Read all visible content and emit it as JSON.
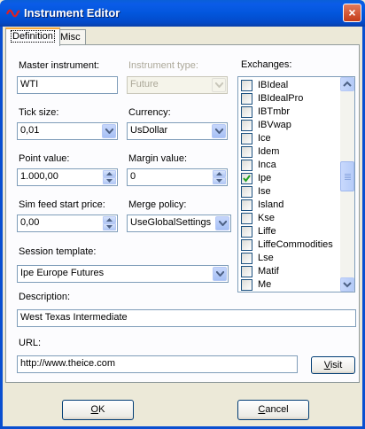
{
  "window": {
    "title": "Instrument Editor",
    "close": "×"
  },
  "tabs": [
    {
      "label": "Definition",
      "active": true
    },
    {
      "label": "Misc",
      "active": false
    }
  ],
  "form": {
    "master_instrument": {
      "label": "Master instrument:",
      "value": "WTI"
    },
    "instrument_type": {
      "label": "Instrument type:",
      "value": "Future"
    },
    "tick_size": {
      "label": "Tick size:",
      "value": "0,01"
    },
    "currency": {
      "label": "Currency:",
      "value": "UsDollar"
    },
    "point_value": {
      "label": "Point value:",
      "value": "1.000,00"
    },
    "margin_value": {
      "label": "Margin value:",
      "value": "0"
    },
    "sim_feed_start_price": {
      "label": "Sim feed start price:",
      "value": "0,00"
    },
    "merge_policy": {
      "label": "Merge policy:",
      "value": "UseGlobalSettings"
    },
    "session_template": {
      "label": "Session template:",
      "value": "Ipe Europe Futures"
    },
    "description": {
      "label": "Description:",
      "value": "West Texas Intermediate"
    },
    "url": {
      "label": "URL:",
      "value": "http://www.theice.com"
    }
  },
  "exchanges": {
    "label": "Exchanges:",
    "items": [
      {
        "name": "IBIdeal",
        "checked": false
      },
      {
        "name": "IBIdealPro",
        "checked": false
      },
      {
        "name": "IBTmbr",
        "checked": false
      },
      {
        "name": "IBVwap",
        "checked": false
      },
      {
        "name": "Ice",
        "checked": false
      },
      {
        "name": "Idem",
        "checked": false
      },
      {
        "name": "Inca",
        "checked": false
      },
      {
        "name": "Ipe",
        "checked": true
      },
      {
        "name": "Ise",
        "checked": false
      },
      {
        "name": "Island",
        "checked": false
      },
      {
        "name": "Kse",
        "checked": false
      },
      {
        "name": "Liffe",
        "checked": false
      },
      {
        "name": "LiffeCommodities",
        "checked": false
      },
      {
        "name": "Lse",
        "checked": false
      },
      {
        "name": "Matif",
        "checked": false
      },
      {
        "name": "Me",
        "checked": false
      }
    ]
  },
  "buttons": {
    "visit_u": "V",
    "visit_rest": "isit",
    "ok_u": "O",
    "ok_rest": "K",
    "cancel_u": "C",
    "cancel_rest": "ancel"
  },
  "colors": {
    "titlebar": "#0256dc",
    "background": "#ece9d8",
    "checkmark": "#21a121"
  }
}
